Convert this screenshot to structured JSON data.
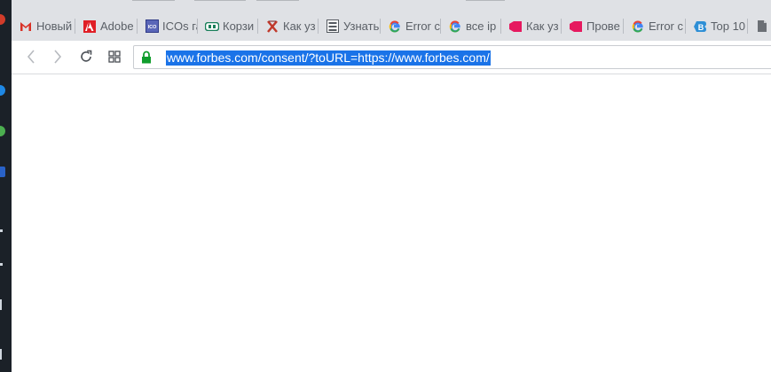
{
  "browser": {
    "tabs": [
      {
        "label": "Новый",
        "icon": "gmail-icon",
        "color": "#d93025"
      },
      {
        "label": "Adobe",
        "icon": "adobe-icon",
        "color": "#e01f26"
      },
      {
        "label": "ICOs га",
        "icon": "ico-icon",
        "color": "#4452a8"
      },
      {
        "label": "Корзи",
        "icon": "cart-icon",
        "color": "#1a7f5a"
      },
      {
        "label": "Как уз",
        "icon": "x-logo-icon",
        "color": "#c0392b"
      },
      {
        "label": "Узнать",
        "icon": "list-icon",
        "color": "#555a60"
      },
      {
        "label": "Error c",
        "icon": "google-icon",
        "color": "#4285f4"
      },
      {
        "label": "все ip",
        "icon": "google-icon",
        "color": "#4285f4"
      },
      {
        "label": "Как уз",
        "icon": "tag-icon",
        "color": "#e6195f"
      },
      {
        "label": "Прове",
        "icon": "tag-icon",
        "color": "#e6195f"
      },
      {
        "label": "Error c",
        "icon": "google-icon",
        "color": "#4285f4"
      },
      {
        "label": "Top 10",
        "icon": "b-logo-icon",
        "color": "#2e8fd6"
      },
      {
        "label": "",
        "icon": "document-icon",
        "color": "#555a60"
      }
    ],
    "address_bar": {
      "url": "www.forbes.com/consent/?toURL=https://www.forbes.com/"
    }
  }
}
